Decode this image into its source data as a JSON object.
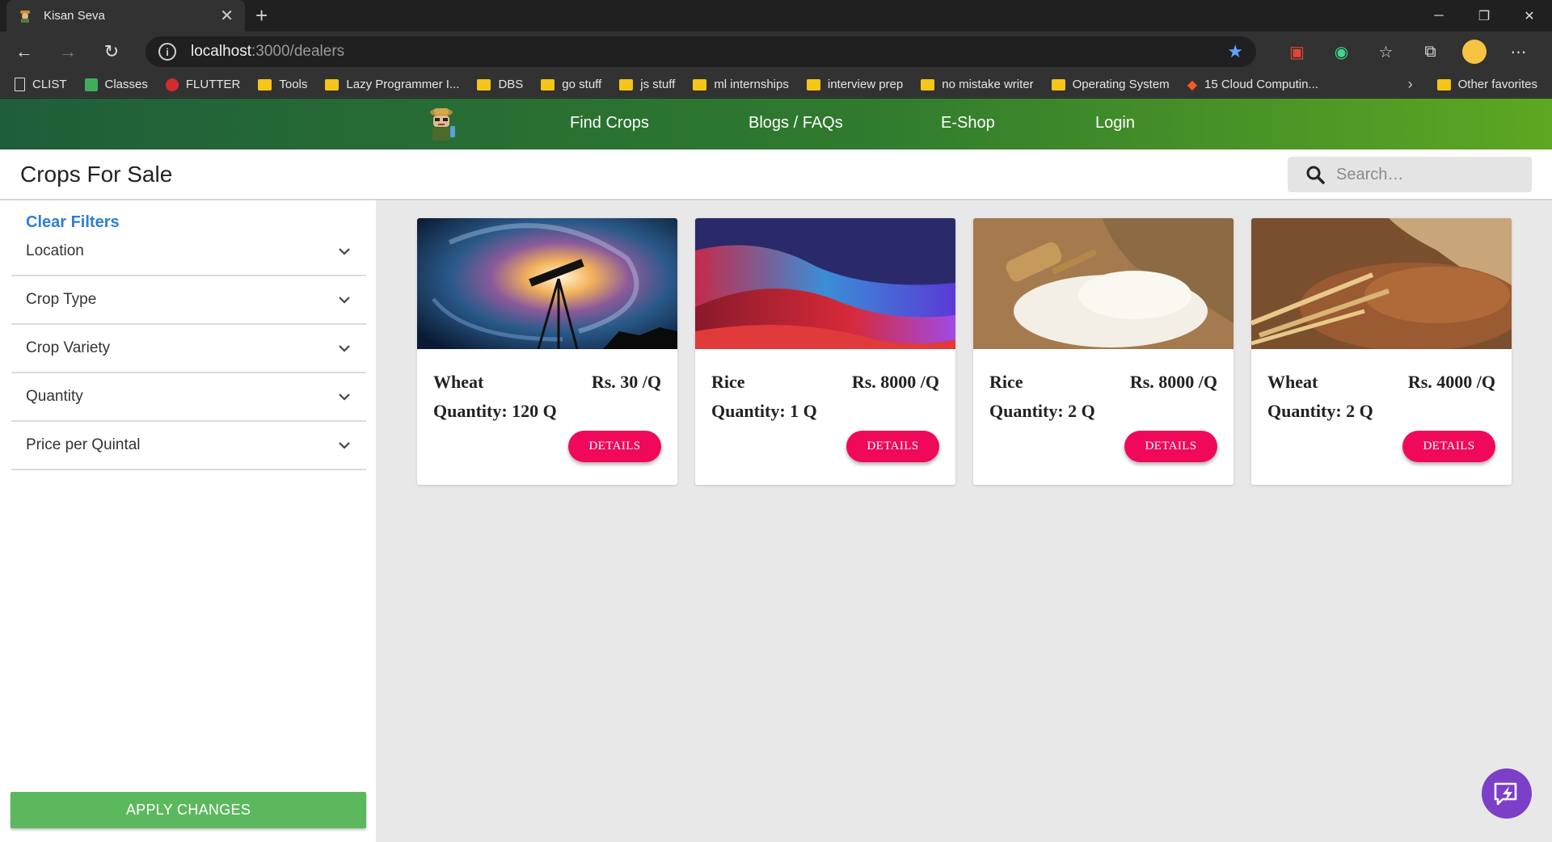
{
  "browser": {
    "tab_title": "Kisan Seva",
    "tab_close": "✕",
    "new_tab": "+",
    "url_host": "localhost",
    "url_path": ":3000/dealers",
    "bookmarks": [
      {
        "label": "CLIST",
        "icon": "page-icon"
      },
      {
        "label": "Classes",
        "icon": "classes-icon"
      },
      {
        "label": "FLUTTER",
        "icon": "flutter-icon"
      },
      {
        "label": "Tools",
        "icon": "folder-icon"
      },
      {
        "label": "Lazy Programmer I...",
        "icon": "folder-icon"
      },
      {
        "label": "DBS",
        "icon": "folder-icon"
      },
      {
        "label": "go stuff",
        "icon": "folder-icon"
      },
      {
        "label": "js stuff",
        "icon": "folder-icon"
      },
      {
        "label": "ml internships",
        "icon": "folder-icon"
      },
      {
        "label": "interview prep",
        "icon": "folder-icon"
      },
      {
        "label": "no mistake writer",
        "icon": "folder-icon"
      },
      {
        "label": "Operating System",
        "icon": "folder-icon"
      },
      {
        "label": "15 Cloud Computin...",
        "icon": "cloud-icon"
      }
    ],
    "other_favorites": "Other favorites"
  },
  "nav": {
    "links": [
      "Find Crops",
      "Blogs / FAQs",
      "E-Shop",
      "Login"
    ]
  },
  "page": {
    "title": "Crops For Sale",
    "search_placeholder": "Search…"
  },
  "sidebar": {
    "clear_filters": "Clear Filters",
    "filters": [
      "Location",
      "Crop Type",
      "Crop Variety",
      "Quantity",
      "Price per Quintal"
    ],
    "apply_label": "APPLY CHANGES"
  },
  "cards": [
    {
      "crop": "Wheat",
      "price": "Rs. 30 /Q",
      "quantity": "Quantity: 120 Q",
      "button": "DETAILS",
      "image": "galaxy-telescope"
    },
    {
      "crop": "Rice",
      "price": "Rs. 8000 /Q",
      "quantity": "Quantity: 1 Q",
      "button": "DETAILS",
      "image": "abstract-waves"
    },
    {
      "crop": "Rice",
      "price": "Rs. 8000 /Q",
      "quantity": "Quantity: 2 Q",
      "button": "DETAILS",
      "image": "rice-sack"
    },
    {
      "crop": "Wheat",
      "price": "Rs. 4000 /Q",
      "quantity": "Quantity: 2 Q",
      "button": "DETAILS",
      "image": "wheat-grain"
    }
  ],
  "colors": {
    "nav_start": "#1f5e3a",
    "nav_end": "#5da722",
    "accent_pink": "#f0095b",
    "apply_green": "#5cb85c",
    "link_blue": "#2c7fd3"
  }
}
